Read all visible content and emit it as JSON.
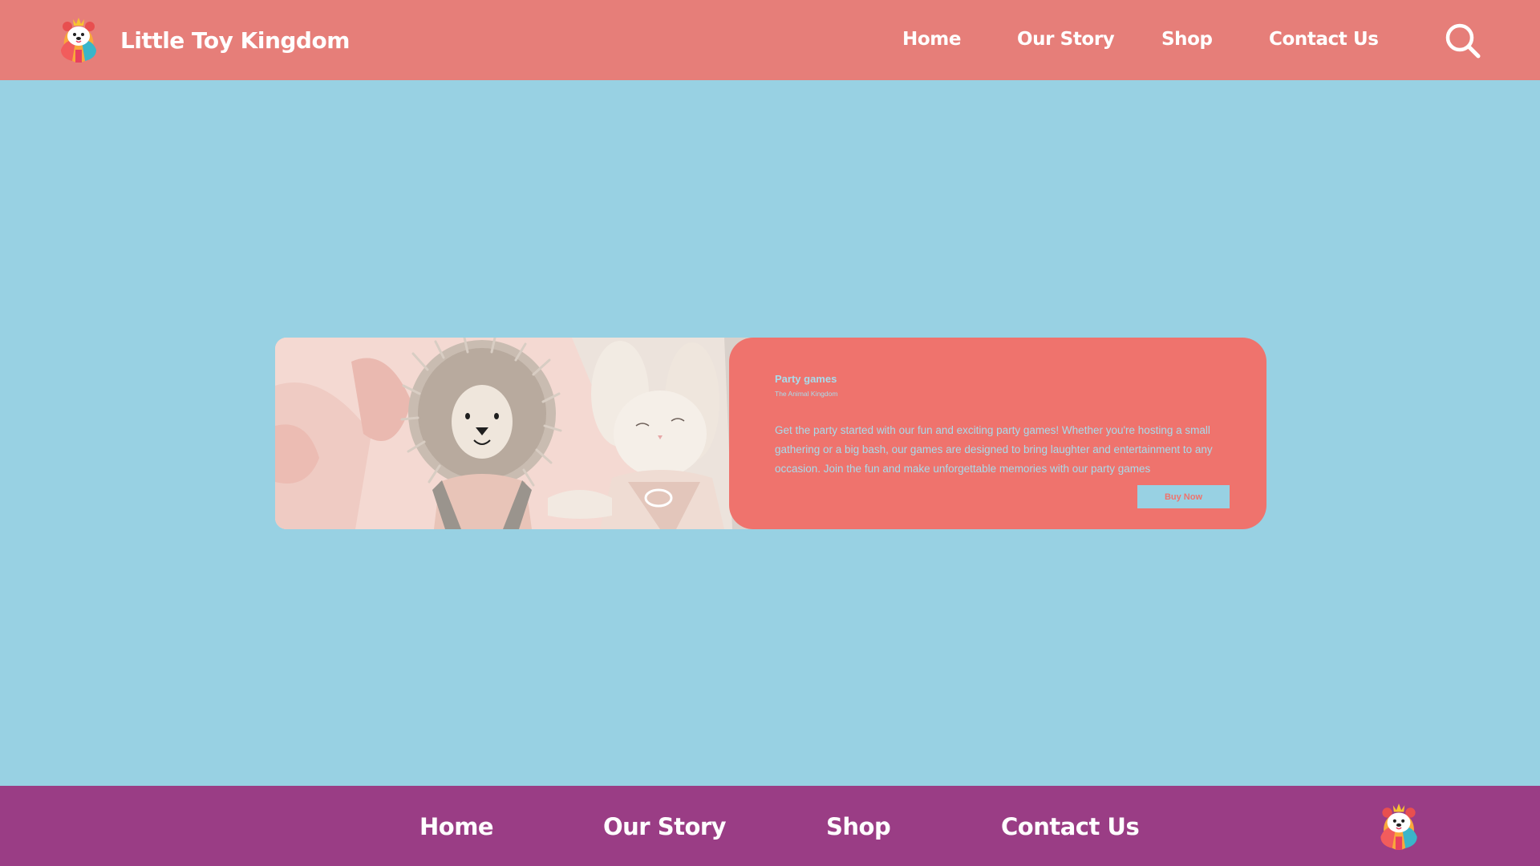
{
  "header": {
    "brand_name": "Little Toy Kingdom",
    "logo_icon": "bear-mascot-logo-icon",
    "nav": [
      {
        "label": "Home"
      },
      {
        "label": "Our Story"
      },
      {
        "label": "Shop"
      },
      {
        "label": "Contact Us"
      }
    ],
    "search_icon": "search-icon"
  },
  "card": {
    "image_alt": "lion and bunny plush toys",
    "title": "Party games",
    "subtitle": "The Animal Kingdom",
    "description": "Get the party started with our fun and exciting party games! Whether you're hosting a small gathering or a big bash, our games are designed to bring laughter and entertainment to any occasion. Join the fun and make unforgettable memories with our party games",
    "button_label": "Buy Now"
  },
  "footer": {
    "nav": [
      {
        "label": "Home"
      },
      {
        "label": "Our Story"
      },
      {
        "label": "Shop"
      },
      {
        "label": "Contact Us"
      }
    ],
    "logo_icon": "bear-mascot-logo-icon"
  },
  "colors": {
    "header_bg": "#e67e79",
    "page_bg": "#98d1e3",
    "card_panel_bg": "#ef736d",
    "footer_bg": "#9a3d85",
    "text_light": "#ffffff"
  }
}
